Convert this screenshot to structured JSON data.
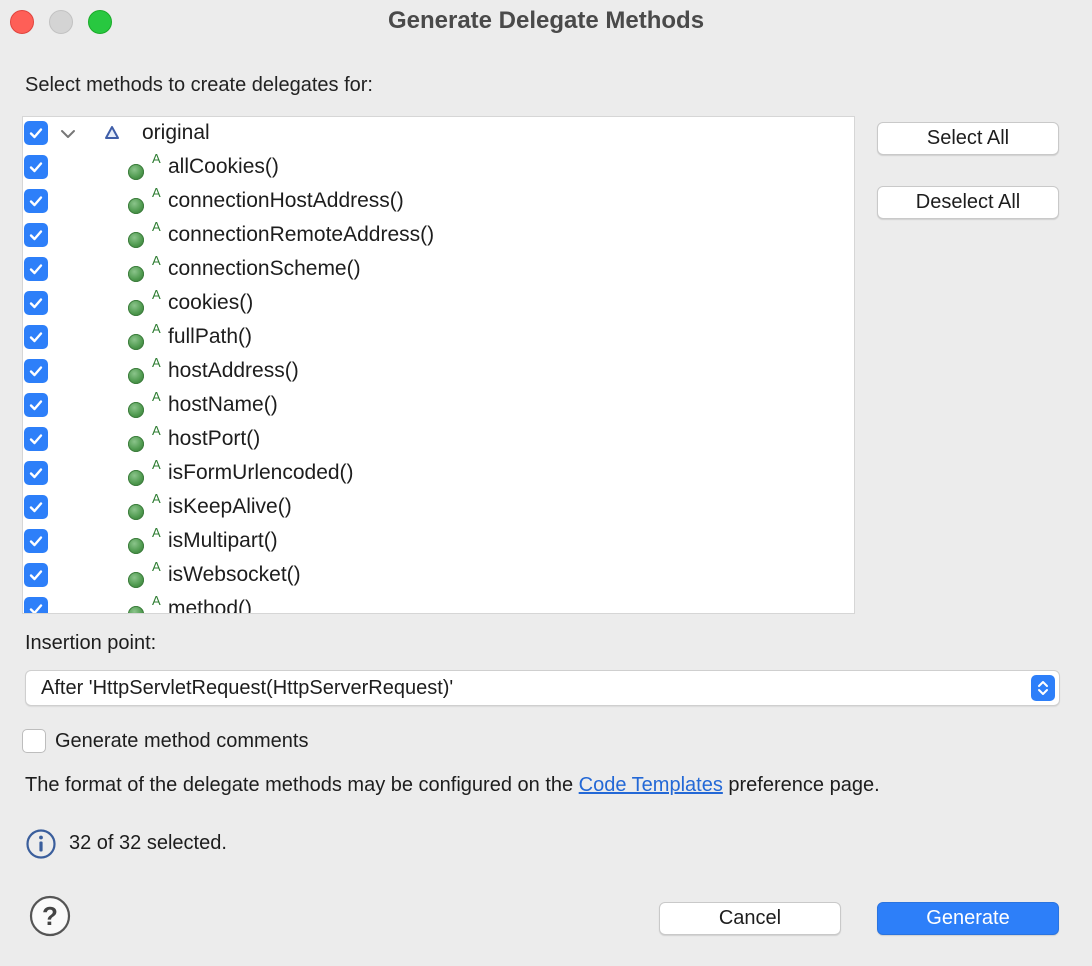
{
  "window": {
    "title": "Generate Delegate Methods"
  },
  "select_label": "Select methods to create delegates for:",
  "tree": {
    "root": {
      "label": "original",
      "checked": true,
      "expanded": true,
      "icon": "package-triangle-icon"
    },
    "methods": [
      "allCookies()",
      "connectionHostAddress()",
      "connectionRemoteAddress()",
      "connectionScheme()",
      "cookies()",
      "fullPath()",
      "hostAddress()",
      "hostName()",
      "hostPort()",
      "isFormUrlencoded()",
      "isKeepAlive()",
      "isMultipart()",
      "isWebsocket()",
      "method()"
    ],
    "method_marker": "A"
  },
  "buttons": {
    "select_all": "Select All",
    "deselect_all": "Deselect All",
    "cancel": "Cancel",
    "generate": "Generate"
  },
  "insertion": {
    "label": "Insertion point:",
    "value": "After 'HttpServletRequest(HttpServerRequest)'"
  },
  "comments": {
    "label": "Generate method comments",
    "checked": false
  },
  "format_note": {
    "before": "The format of the delegate methods may be configured on the ",
    "link": "Code Templates",
    "after": " preference page."
  },
  "status": {
    "text": "32 of 32 selected."
  },
  "colors": {
    "accent": "#2d7ff9",
    "method_dot": "#4f9a4f",
    "link": "#2368d6"
  }
}
